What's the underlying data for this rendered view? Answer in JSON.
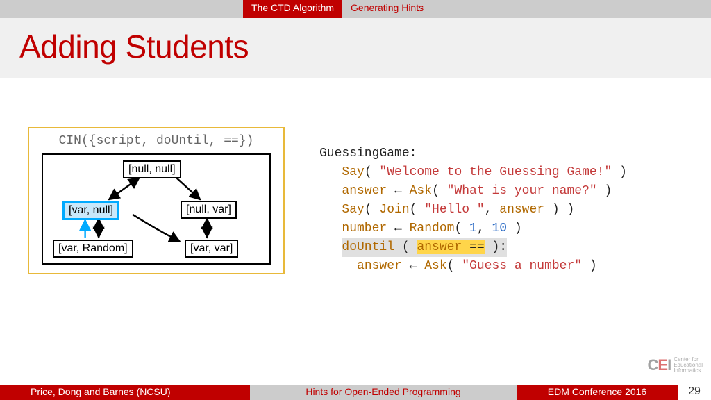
{
  "topbar": {
    "crumb_active": "The CTD Algorithm",
    "crumb_next": "Generating Hints"
  },
  "title": "Adding Students",
  "diagram": {
    "caption": "CIN({script, doUntil, ==})",
    "nodes": {
      "top": "[null, null]",
      "left_mid": "[var, null]",
      "right_mid": "[null, var]",
      "left_bot": "[var, Random]",
      "right_bot": "[var, var]"
    }
  },
  "code": {
    "header": "GuessingGame:",
    "l1_say": "Say",
    "l1_str": "\"Welcome to the Guessing Game!\"",
    "l2_ans": "answer",
    "l2_ask": "Ask",
    "l2_str": "\"What is your name?\"",
    "l3_say": "Say",
    "l3_join": "Join",
    "l3_str": "\"Hello \"",
    "l3_ans": "answer",
    "l4_num": "number",
    "l4_rand": "Random",
    "l4_a": "1",
    "l4_b": "10",
    "l5_do": "doUntil",
    "l5_ans": "answer",
    "l5_op": "==",
    "l6_ans": "answer",
    "l6_ask": "Ask",
    "l6_str": "\"Guess a number\""
  },
  "logo": {
    "mark_c": "C",
    "mark_e": "E",
    "mark_i": "I",
    "line1": "Center for",
    "line2": "Educational",
    "line3": "Informatics"
  },
  "footer": {
    "authors": "Price, Dong and Barnes (NCSU)",
    "talk": "Hints for Open-Ended Programming",
    "venue": "EDM Conference 2016",
    "page": "29"
  }
}
